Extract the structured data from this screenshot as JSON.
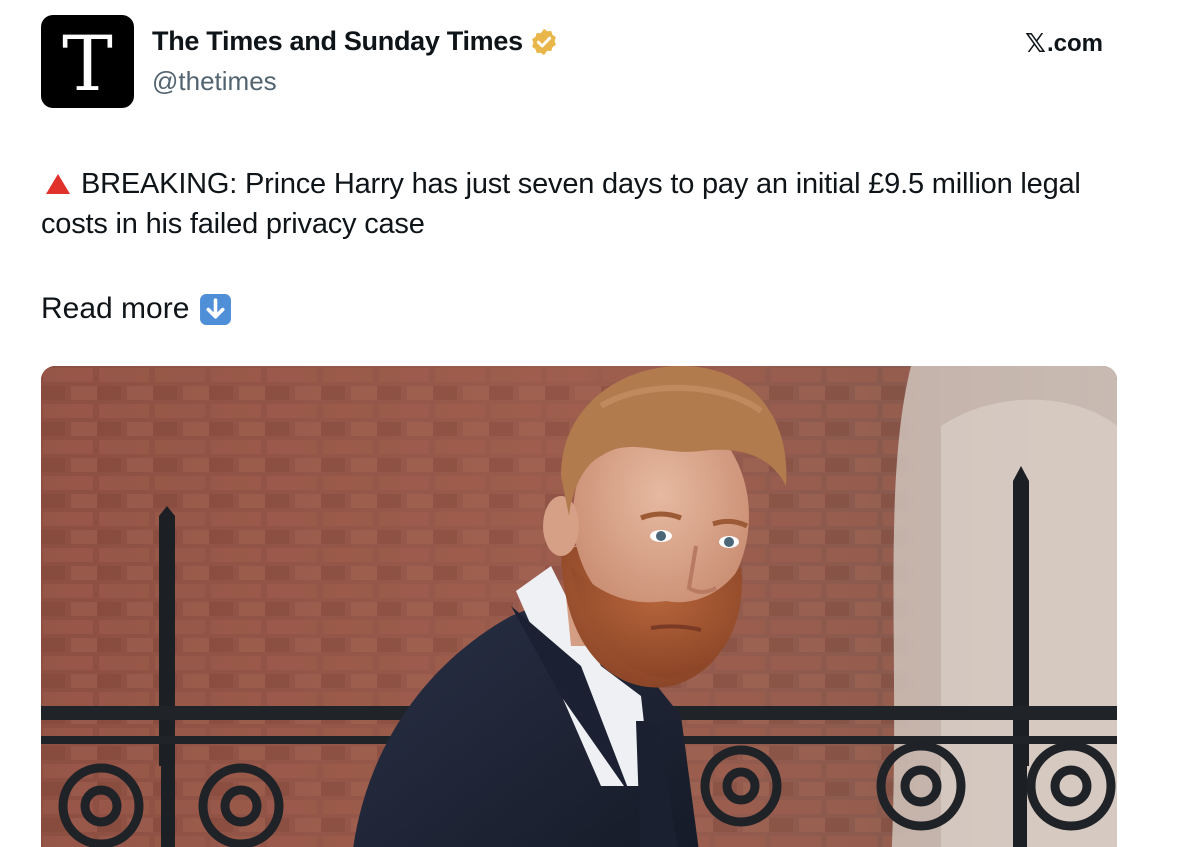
{
  "author": {
    "avatar_letter": "T",
    "name": "The Times and Sunday Times",
    "handle": "@thetimes",
    "verified_icon": "gold-verified-badge-icon"
  },
  "source": {
    "logo": "𝕏",
    "label": ".com"
  },
  "post": {
    "alert_icon": "red-triangle-icon",
    "text": "BREAKING: Prince Harry has just seven days to pay an initial £9.5 million legal costs in his failed privacy case",
    "read_more": "Read more",
    "read_more_icon": "down-arrow-icon"
  },
  "colors": {
    "verified": "#e9b64a",
    "alert": "#e0322b",
    "down_arrow_box": "#4f8fd8",
    "handle": "#536471"
  },
  "media": {
    "image_icon": "photo-man-in-suit-by-brick-wall"
  }
}
